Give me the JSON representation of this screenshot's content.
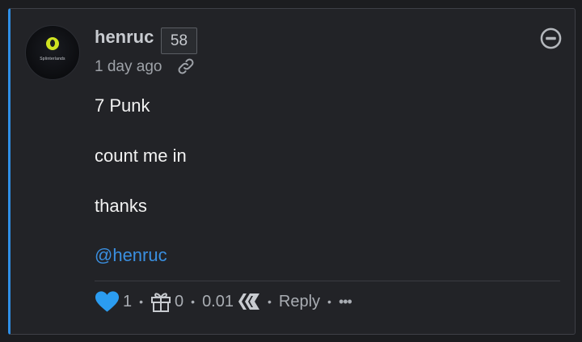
{
  "comment": {
    "author": "henruc",
    "reputation": "58",
    "time_ago": "1 day ago",
    "avatar_text": "Splinterlands",
    "body": {
      "line1": "7 Punk",
      "line2": "count me in",
      "line3": "thanks",
      "mention": "@henruc"
    },
    "footer": {
      "votes": "1",
      "gifts": "0",
      "payout": "0.01",
      "reply_label": "Reply",
      "more_label": "•••",
      "separator": "•"
    }
  },
  "colors": {
    "accent": "#2f8fe6",
    "heart": "#2b9cf0",
    "mention": "#3a8fe0",
    "background": "#222327"
  },
  "icons": {
    "link": "link-icon",
    "collapse": "minus-circle-icon",
    "vote": "heart-icon",
    "gift": "gift-icon",
    "currency": "hive-icon"
  }
}
